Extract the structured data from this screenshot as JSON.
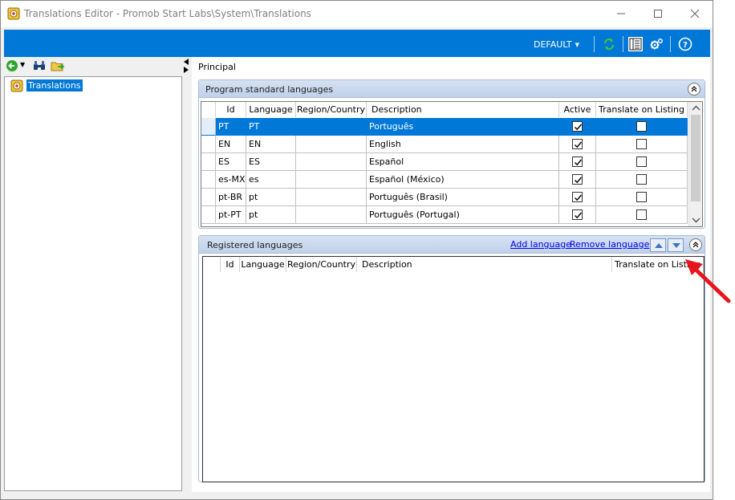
{
  "window": {
    "title": "Translations Editor - Promob Start Labs\\System\\Translations"
  },
  "toolbar": {
    "profile_label": "DEFAULT"
  },
  "tree": {
    "root_label": "Translations"
  },
  "main": {
    "tab_label": "Principal",
    "standard_group": {
      "title": "Program standard languages",
      "columns": [
        "Id",
        "Language",
        "Region/Country",
        "Description",
        "Active",
        "Translate on Listing"
      ],
      "rows": [
        {
          "id": "PT",
          "language": "PT",
          "region": "",
          "description": "Português",
          "active": true,
          "translate": false
        },
        {
          "id": "EN",
          "language": "EN",
          "region": "",
          "description": "English",
          "active": true,
          "translate": false
        },
        {
          "id": "ES",
          "language": "ES",
          "region": "",
          "description": "Español",
          "active": true,
          "translate": false
        },
        {
          "id": "es-MX",
          "language": "es",
          "region": "",
          "description": "Español (México)",
          "active": true,
          "translate": false
        },
        {
          "id": "pt-BR",
          "language": "pt",
          "region": "",
          "description": "Português (Brasil)",
          "active": true,
          "translate": false
        },
        {
          "id": "pt-PT",
          "language": "pt",
          "region": "",
          "description": "Português (Portugal)",
          "active": true,
          "translate": false
        }
      ],
      "selected_row": 0
    },
    "registered_group": {
      "title": "Registered languages",
      "add_link": "Add language",
      "remove_link": "Remove language",
      "columns": [
        "Id",
        "Language",
        "Region/Country",
        "Description",
        "Translate on Listing"
      ]
    }
  },
  "colors": {
    "accent": "#0078d7",
    "group_header": "#c8d7ee",
    "annotation_arrow": "#e8141b"
  }
}
